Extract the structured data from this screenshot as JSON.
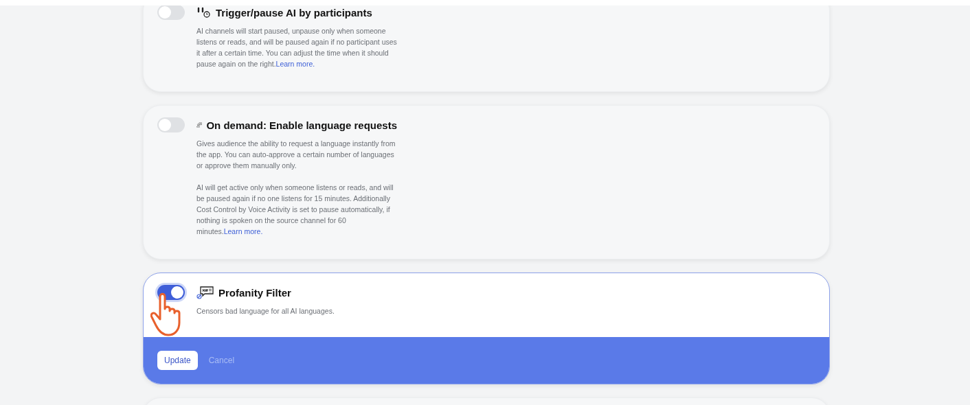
{
  "settings": [
    {
      "kind": "participants",
      "title": "Trigger/pause AI by participants",
      "on": false,
      "paragraphs": [
        {
          "text": "AI channels will start paused, unpause only when someone listens or reads, and will be paused again if no participant uses it after a certain time. You can adjust the time when it should pause again on the right.",
          "link": "Learn more."
        }
      ]
    },
    {
      "kind": "requests",
      "title": "On demand: Enable language requests",
      "on": false,
      "paragraphs": [
        {
          "text": "Gives audience the ability to request a language instantly from the app. You can auto-approve a certain number of languages or approve them manually only."
        },
        {
          "text": "AI will get active only when someone listens or reads, and will be paused again if no one listens for 15 minutes. Additionally Cost Control by Voice Activity is set to pause automatically, if nothing is spoken on the source channel for 60 minutes.",
          "link": "Learn more."
        }
      ]
    },
    {
      "kind": "profanity",
      "title": "Profanity Filter",
      "on": true,
      "paragraphs": [
        {
          "text": "Censors bad language for all AI languages."
        }
      ],
      "footer": {
        "primary": "Update",
        "secondary": "Cancel"
      }
    }
  ],
  "cursor": {
    "visible": true
  }
}
